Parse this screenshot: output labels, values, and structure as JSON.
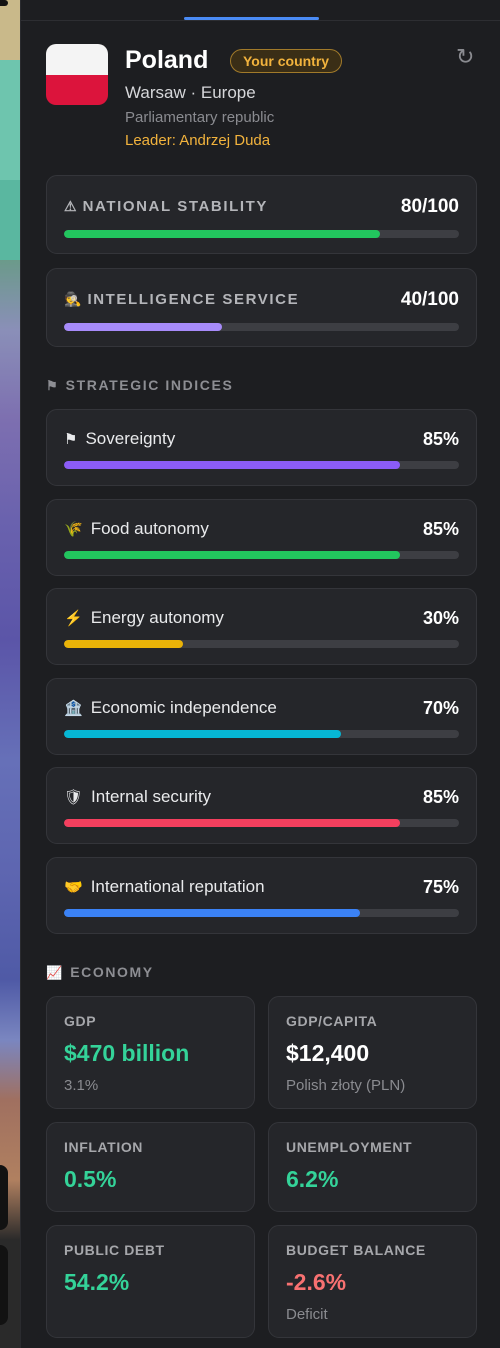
{
  "country": {
    "name": "Poland",
    "badge": "Your country",
    "capital_region": "Warsaw · Europe",
    "government": "Parliamentary republic",
    "leader": "Leader: Andrzej Duda",
    "flag_colors": [
      "#f4f4f4",
      "#dc143c"
    ]
  },
  "header_icons": {
    "refresh": "refresh-icon"
  },
  "national_stability": {
    "icon": "⚠",
    "label": "NATIONAL STABILITY",
    "value": "80/100",
    "level": 0.8,
    "color": "#22c55e"
  },
  "intelligence_service": {
    "icon": "🕵",
    "label": "INTELLIGENCE SERVICE",
    "value": "40/100",
    "level": 0.4,
    "color": "#a78bfa"
  },
  "strategic": {
    "title": "STRATEGIC INDICES",
    "icon": "⚑",
    "items": [
      {
        "icon": "⚑",
        "label": "Sovereignty",
        "value": "85%",
        "level": 0.85,
        "color": "#8b5cf6"
      },
      {
        "icon": "🌾",
        "label": "Food autonomy",
        "value": "85%",
        "level": 0.85,
        "color": "#22c55e"
      },
      {
        "icon": "⚡",
        "label": "Energy autonomy",
        "value": "30%",
        "level": 0.3,
        "color": "#eab308"
      },
      {
        "icon": "🏦",
        "label": "Economic independence",
        "value": "70%",
        "level": 0.7,
        "color": "#06b6d4"
      },
      {
        "icon": "🛡",
        "label": "Internal security",
        "value": "85%",
        "level": 0.85,
        "color": "#f43f5e"
      },
      {
        "icon": "🤝",
        "label": "International reputation",
        "value": "75%",
        "level": 0.75,
        "color": "#3b82f6"
      }
    ]
  },
  "economy": {
    "title": "ECONOMY",
    "icon": "📈",
    "gdp": {
      "label": "GDP",
      "value": "$470 billion",
      "sub": "3.1%"
    },
    "gdp_capita": {
      "label": "GDP/CAPITA",
      "value": "$12,400",
      "sub": "Polish złoty (PLN)"
    },
    "inflation": {
      "label": "INFLATION",
      "value": "0.5%"
    },
    "unemployment": {
      "label": "UNEMPLOYMENT",
      "value": "6.2%"
    },
    "public_debt": {
      "label": "PUBLIC DEBT",
      "value": "54.2%"
    },
    "budget_balance": {
      "label": "BUDGET BALANCE",
      "value": "-2.6%",
      "sub": "Deficit"
    }
  }
}
